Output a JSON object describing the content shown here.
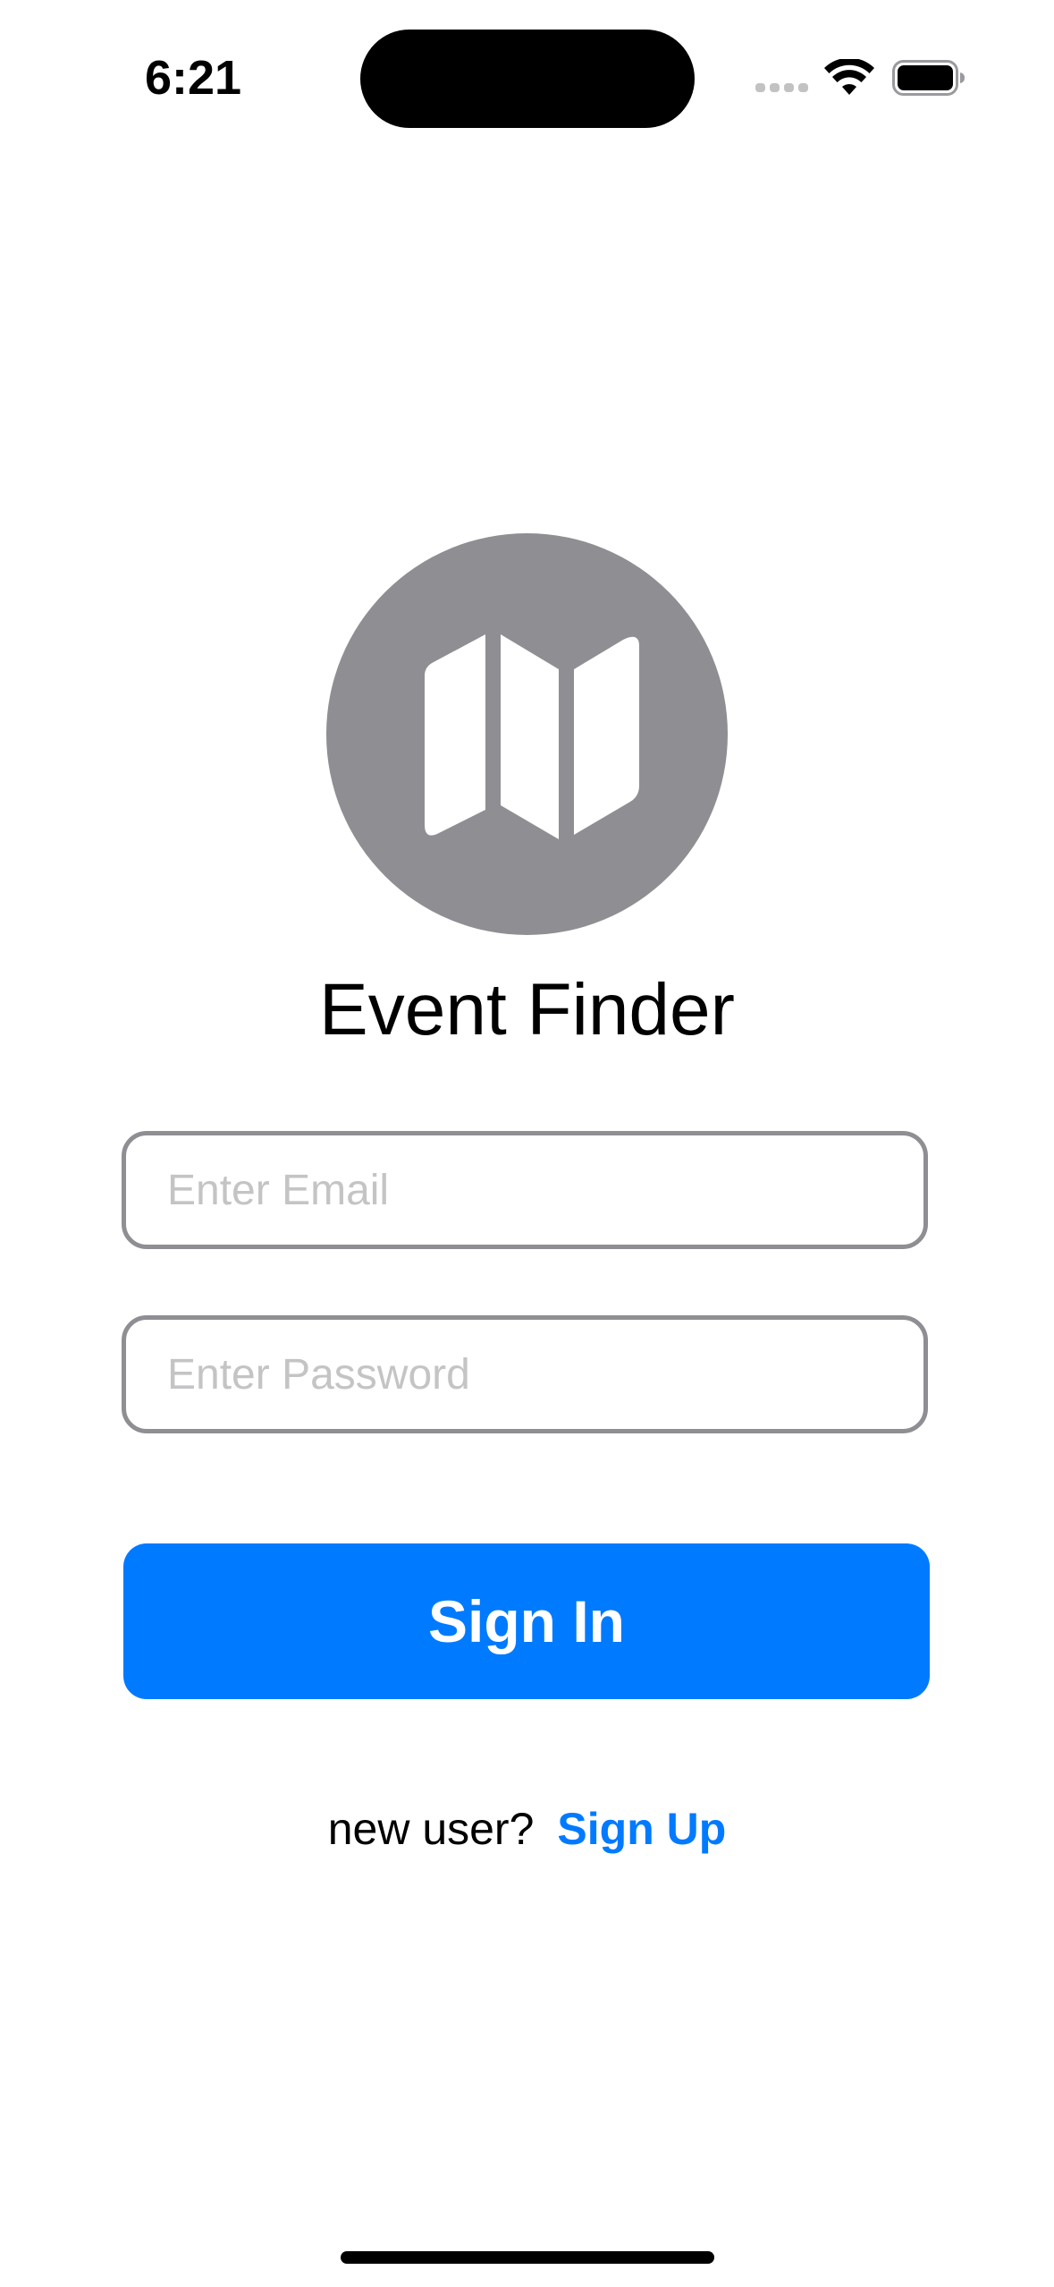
{
  "status_bar": {
    "time": "6:21",
    "icons": [
      "cellular-signal-icon",
      "wifi-icon",
      "battery-icon"
    ]
  },
  "logo": {
    "icon": "map-icon",
    "background_color": "#8e8e93"
  },
  "app_title": "Event Finder",
  "email_field": {
    "value": "",
    "placeholder": "Enter Email"
  },
  "password_field": {
    "value": "",
    "placeholder": "Enter Password"
  },
  "sign_in_button": {
    "label": "Sign In",
    "color": "#007aff"
  },
  "signup": {
    "prompt": "new user?",
    "link_label": "Sign Up"
  }
}
